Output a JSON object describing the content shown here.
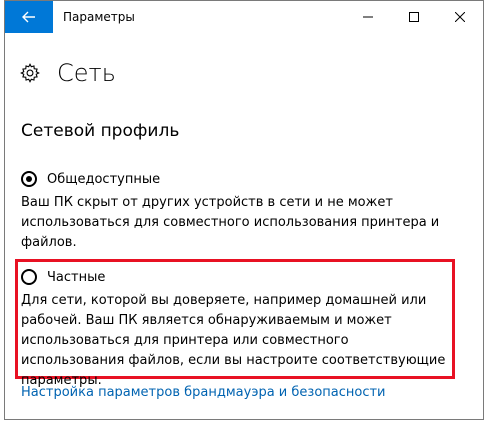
{
  "window": {
    "title": "Параметры"
  },
  "icons": {
    "back": "back-arrow-icon",
    "settings": "gear-icon",
    "minimize": "minimize-icon",
    "maximize": "maximize-icon",
    "close": "close-icon"
  },
  "colors": {
    "back_button_bg": "#0078d7",
    "link": "#0063b1",
    "highlight_border": "#e81123"
  },
  "page": {
    "title": "Сеть",
    "section_title": "Сетевой профиль"
  },
  "profiles": [
    {
      "label": "Общедоступные",
      "selected": true,
      "description": "Ваш ПК скрыт от других устройств в сети и не может использоваться для совместного использования принтера и файлов."
    },
    {
      "label": "Частные",
      "selected": false,
      "description": "Для сети, которой вы доверяете, например домашней или рабочей. Ваш ПК является обнаруживаемым и может использоваться для принтера или совместного использования файлов, если вы настроите соответствующие параметры."
    }
  ],
  "link": {
    "firewall": "Настройка параметров брандмауэра и безопасности"
  }
}
